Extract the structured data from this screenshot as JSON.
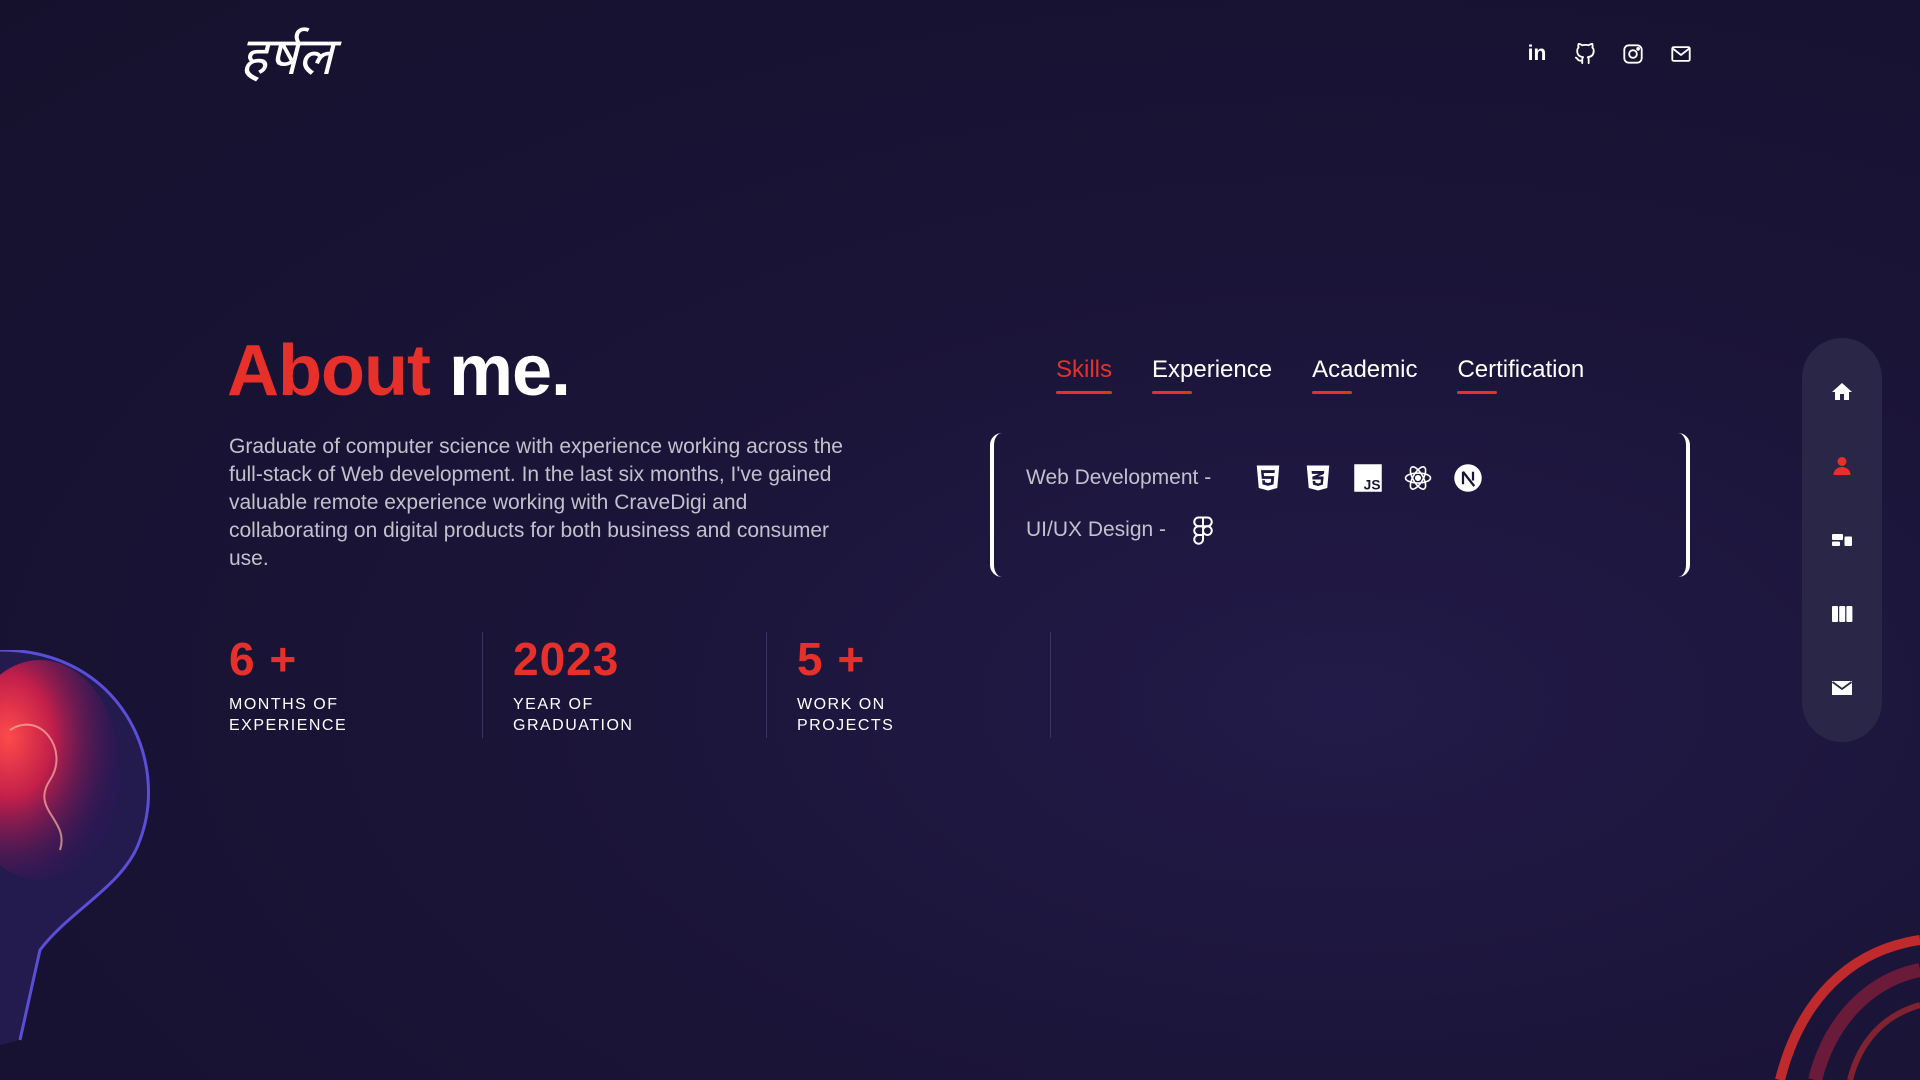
{
  "header": {
    "logo_text": "हर्षल",
    "social_icons": [
      "linkedin-icon",
      "github-icon",
      "instagram-icon",
      "mail-icon"
    ],
    "linkedin_text": "in"
  },
  "about": {
    "title_accent": "About",
    "title_rest": "me.",
    "description": "Graduate of computer science with experience working across the full-stack of Web development. In the last six months, I've gained valuable remote experience working with CraveDigi and collaborating on digital products for both business and consumer use."
  },
  "stats": [
    {
      "value": "6 +",
      "label": "MONTHS OF EXPERIENCE"
    },
    {
      "value": "2023",
      "label": "YEAR OF GRADUATION"
    },
    {
      "value": "5 +",
      "label": "WORK ON PROJECTS"
    }
  ],
  "tabs": [
    {
      "label": "Skills",
      "active": true
    },
    {
      "label": "Experience",
      "active": false
    },
    {
      "label": "Academic",
      "active": false
    },
    {
      "label": "Certification",
      "active": false
    }
  ],
  "skills": [
    {
      "label": "Web Development  -",
      "icons": [
        "html5-icon",
        "css3-icon",
        "javascript-icon",
        "react-icon",
        "nextjs-icon"
      ]
    },
    {
      "label": "UI/UX Design  -",
      "icons": [
        "figma-icon"
      ]
    }
  ],
  "side_nav": {
    "items": [
      "home-icon",
      "about-user-icon",
      "services-icon",
      "work-icon",
      "contact-mail-icon"
    ],
    "active_index": 1
  },
  "colors": {
    "accent": "#e8302a",
    "background": "#1a1437",
    "text_muted": "#c2c1cc",
    "nav_bg": "#2a2648"
  }
}
